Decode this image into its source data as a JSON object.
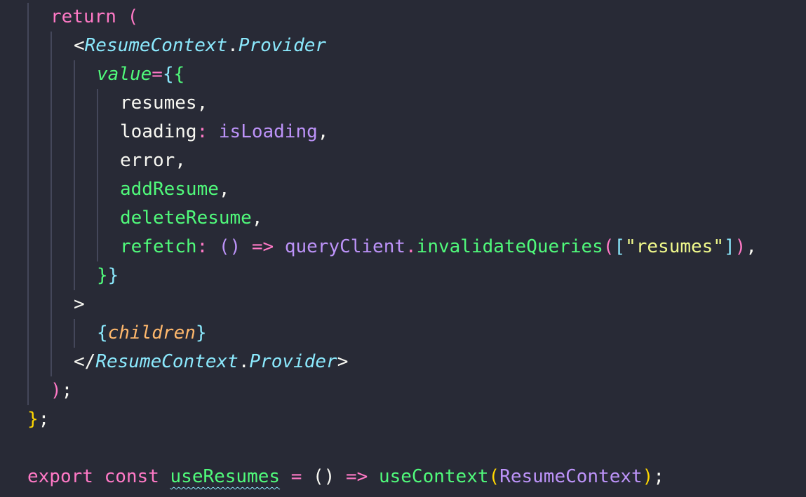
{
  "colors": {
    "background": "#282a36",
    "guide": "#44475a",
    "keyword": "#ff79c6",
    "function": "#50fa7b",
    "variable": "#f8f8f2",
    "property": "#bd93f9",
    "tag": "#8be9fd",
    "string": "#f1fa8c",
    "param": "#ffb86c",
    "bracket_gold": "#ffd700",
    "bracket_pink": "#ff79c6",
    "bracket_blue": "#8be9fd"
  },
  "code": {
    "lines": [
      {
        "indent": 72,
        "tokens": [
          {
            "text": "return",
            "color": "#ff79c6"
          },
          {
            "text": " ",
            "color": "#f8f8f2"
          },
          {
            "text": "(",
            "color": "#ff79c6"
          }
        ]
      },
      {
        "indent": 105,
        "tokens": [
          {
            "text": "<",
            "color": "#f8f8f2"
          },
          {
            "text": "ResumeContext",
            "color": "#8be9fd",
            "italic": true
          },
          {
            "text": ".",
            "color": "#f8f8f2"
          },
          {
            "text": "Provider",
            "color": "#8be9fd",
            "italic": true
          }
        ]
      },
      {
        "indent": 138,
        "tokens": [
          {
            "text": "value",
            "color": "#50fa7b",
            "italic": true
          },
          {
            "text": "=",
            "color": "#ff79c6"
          },
          {
            "text": "{",
            "color": "#8be9fd"
          },
          {
            "text": "{",
            "color": "#50fa7b"
          }
        ]
      },
      {
        "indent": 171,
        "tokens": [
          {
            "text": "resumes",
            "color": "#f8f8f2"
          },
          {
            "text": ",",
            "color": "#f8f8f2"
          }
        ]
      },
      {
        "indent": 171,
        "tokens": [
          {
            "text": "loading",
            "color": "#f8f8f2"
          },
          {
            "text": ": ",
            "color": "#ff79c6"
          },
          {
            "text": "isLoading",
            "color": "#bd93f9"
          },
          {
            "text": ",",
            "color": "#f8f8f2"
          }
        ]
      },
      {
        "indent": 171,
        "tokens": [
          {
            "text": "error",
            "color": "#f8f8f2"
          },
          {
            "text": ",",
            "color": "#f8f8f2"
          }
        ]
      },
      {
        "indent": 171,
        "tokens": [
          {
            "text": "addResume",
            "color": "#50fa7b"
          },
          {
            "text": ",",
            "color": "#f8f8f2"
          }
        ]
      },
      {
        "indent": 171,
        "tokens": [
          {
            "text": "deleteResume",
            "color": "#50fa7b"
          },
          {
            "text": ",",
            "color": "#f8f8f2"
          }
        ]
      },
      {
        "indent": 171,
        "tokens": [
          {
            "text": "refetch",
            "color": "#50fa7b"
          },
          {
            "text": ": ",
            "color": "#ff79c6"
          },
          {
            "text": "()",
            "color": "#bd93f9"
          },
          {
            "text": " ",
            "color": "#f8f8f2"
          },
          {
            "text": "=>",
            "color": "#ff79c6"
          },
          {
            "text": " ",
            "color": "#f8f8f2"
          },
          {
            "text": "queryClient",
            "color": "#bd93f9"
          },
          {
            "text": ".",
            "color": "#ff79c6"
          },
          {
            "text": "invalidateQueries",
            "color": "#50fa7b"
          },
          {
            "text": "(",
            "color": "#ff79c6"
          },
          {
            "text": "[",
            "color": "#8be9fd"
          },
          {
            "text": "\"resumes\"",
            "color": "#f1fa8c"
          },
          {
            "text": "]",
            "color": "#8be9fd"
          },
          {
            "text": ")",
            "color": "#ff79c6"
          },
          {
            "text": ",",
            "color": "#f8f8f2"
          }
        ]
      },
      {
        "indent": 138,
        "tokens": [
          {
            "text": "}",
            "color": "#50fa7b"
          },
          {
            "text": "}",
            "color": "#8be9fd"
          }
        ]
      },
      {
        "indent": 105,
        "tokens": [
          {
            "text": ">",
            "color": "#f8f8f2"
          }
        ]
      },
      {
        "indent": 138,
        "tokens": [
          {
            "text": "{",
            "color": "#8be9fd"
          },
          {
            "text": "children",
            "color": "#ffb86c",
            "italic": true
          },
          {
            "text": "}",
            "color": "#8be9fd"
          }
        ]
      },
      {
        "indent": 105,
        "tokens": [
          {
            "text": "</",
            "color": "#f8f8f2"
          },
          {
            "text": "ResumeContext",
            "color": "#8be9fd",
            "italic": true
          },
          {
            "text": ".",
            "color": "#f8f8f2"
          },
          {
            "text": "Provider",
            "color": "#8be9fd",
            "italic": true
          },
          {
            "text": ">",
            "color": "#f8f8f2"
          }
        ]
      },
      {
        "indent": 72,
        "tokens": [
          {
            "text": ")",
            "color": "#ff79c6"
          },
          {
            "text": ";",
            "color": "#f8f8f2"
          }
        ]
      },
      {
        "indent": 39,
        "tokens": [
          {
            "text": "}",
            "color": "#ffd700"
          },
          {
            "text": ";",
            "color": "#f8f8f2"
          }
        ]
      },
      {
        "indent": 39,
        "tokens": []
      },
      {
        "indent": 39,
        "tokens": [
          {
            "text": "export",
            "color": "#ff79c6"
          },
          {
            "text": " ",
            "color": "#f8f8f2"
          },
          {
            "text": "const",
            "color": "#ff79c6"
          },
          {
            "text": " ",
            "color": "#f8f8f2"
          },
          {
            "text": "useResumes",
            "color": "#50fa7b",
            "squiggle": true
          },
          {
            "text": " ",
            "color": "#f8f8f2"
          },
          {
            "text": "=",
            "color": "#ff79c6"
          },
          {
            "text": " ",
            "color": "#f8f8f2"
          },
          {
            "text": "()",
            "color": "#f8f8f2"
          },
          {
            "text": " ",
            "color": "#f8f8f2"
          },
          {
            "text": "=>",
            "color": "#ff79c6"
          },
          {
            "text": " ",
            "color": "#f8f8f2"
          },
          {
            "text": "useContext",
            "color": "#50fa7b"
          },
          {
            "text": "(",
            "color": "#ffd700"
          },
          {
            "text": "ResumeContext",
            "color": "#bd93f9"
          },
          {
            "text": ")",
            "color": "#ffd700"
          },
          {
            "text": ";",
            "color": "#f8f8f2"
          }
        ]
      }
    ]
  }
}
